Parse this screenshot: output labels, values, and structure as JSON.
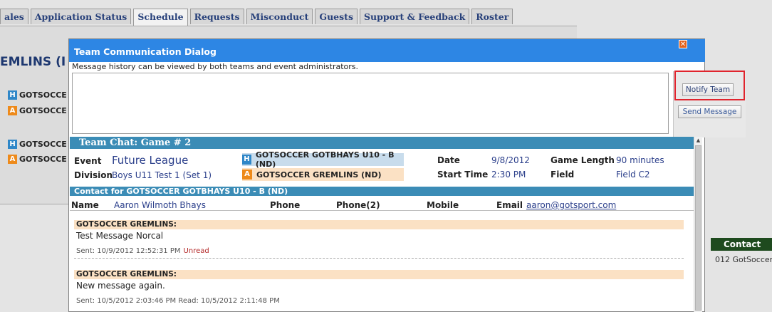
{
  "tabs": [
    "ales",
    "Application Status",
    "Schedule",
    "Requests",
    "Misconduct",
    "Guests",
    "Support & Feedback",
    "Roster"
  ],
  "active_tab": "Schedule",
  "background": {
    "title": "EMLINS (I",
    "teams": [
      {
        "badge": "H",
        "name": "GOTSOCCE"
      },
      {
        "badge": "A",
        "name": "GOTSOCCE"
      },
      {
        "badge": "H",
        "name": "GOTSOCCE"
      },
      {
        "badge": "A",
        "name": "GOTSOCCE"
      }
    ],
    "contact_bar": "Contact",
    "copyright": "012 GotSoccer,"
  },
  "dialog": {
    "title": "Team Communication Dialog",
    "info": "Message history can be viewed by both teams and event administrators.",
    "message_value": "",
    "close_glyph": "✕",
    "notify_label": "Notify Team",
    "send_label": "Send Message"
  },
  "chat": {
    "header": "Team Chat: Game # 2",
    "event_label": "Event",
    "event_value": "Future League",
    "division_label": "Division",
    "division_value": "Boys U11 Test 1 (Set 1)",
    "home_badge": "H",
    "home_team": "GOTSOCCER GOTBHAYS U10 - B (ND)",
    "away_badge": "A",
    "away_team": "GOTSOCCER GREMLINS (ND)",
    "date_label": "Date",
    "date_value": "9/8/2012",
    "start_label": "Start Time",
    "start_value": "2:30 PM",
    "length_label": "Game Length",
    "length_value": "90 minutes",
    "field_label": "Field",
    "field_value": "Field C2",
    "contact_header": "Contact for GOTSOCCER GOTBHAYS U10 - B (ND)",
    "contact": {
      "name_label": "Name",
      "name_value": "Aaron Wilmoth Bhays",
      "phone_label": "Phone",
      "phone2_label": "Phone(2)",
      "mobile_label": "Mobile",
      "email_label": "Email",
      "email_value": "aaron@gotsport.com"
    },
    "messages": [
      {
        "sender": "GOTSOCCER GREMLINS:",
        "text": "Test Message Norcal",
        "meta": "Sent: 10/9/2012 12:52:31 PM",
        "status": "Unread"
      },
      {
        "sender": "GOTSOCCER GREMLINS:",
        "text": "New message again.",
        "meta": "Sent: 10/5/2012 2:03:46 PM   Read: 10/5/2012 2:11:48 PM",
        "status": ""
      }
    ]
  },
  "colors": {
    "title_bar": "#2d86e4",
    "section_bar": "#3b8cb6",
    "home": "#2f87c8",
    "away": "#ee8a1a",
    "highlight": "#e0242d"
  }
}
